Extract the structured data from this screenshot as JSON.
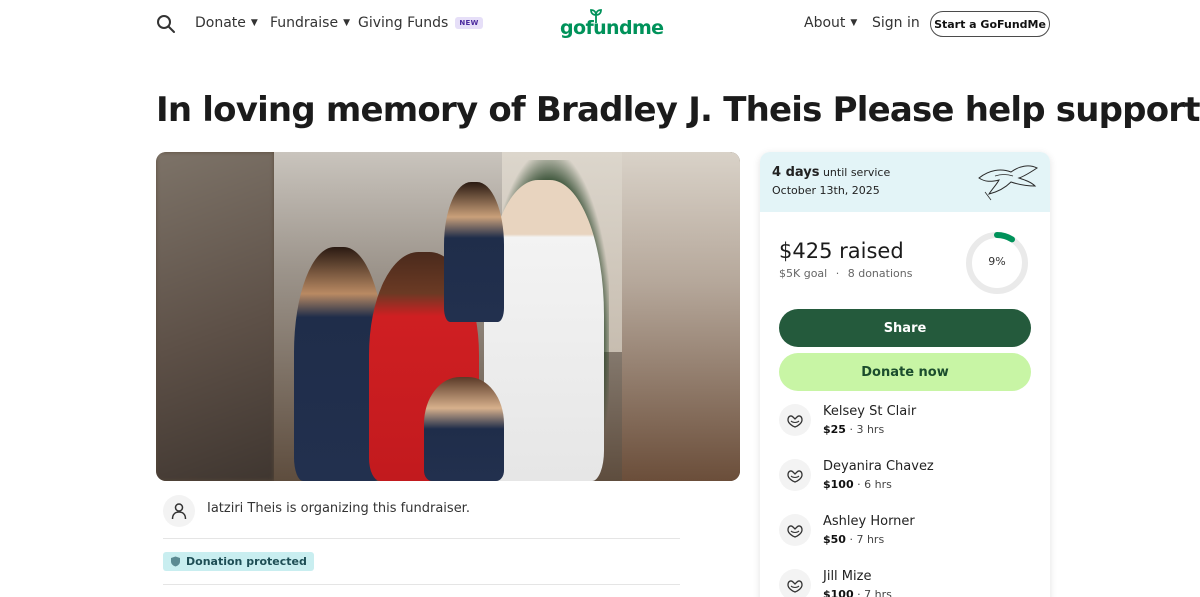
{
  "header": {
    "donate_label": "Donate",
    "fundraise_label": "Fundraise",
    "giving_funds_label": "Giving Funds",
    "new_badge": "NEW",
    "logo_text": "gofundme",
    "about_label": "About",
    "signin_label": "Sign in",
    "start_label": "Start a GoFundMe"
  },
  "campaign": {
    "title": "In loving memory of Bradley J. Theis Please help support",
    "organizer_text": "Iatziri Theis is organizing this fundraiser.",
    "protected_label": "Donation protected"
  },
  "card": {
    "days_bold": "4 days",
    "days_rest": " until service",
    "service_date": "October 13th, 2025",
    "raised": "$425 raised",
    "goal": "$5K goal",
    "separator": "·",
    "donations": "8 donations",
    "progress_percent": 9,
    "progress_label": "9%",
    "share_label": "Share",
    "donate_label": "Donate now"
  },
  "donors": [
    {
      "name": "Kelsey St Clair",
      "amount": "$25",
      "time": " · 3 hrs"
    },
    {
      "name": "Deyanira Chavez",
      "amount": "$100",
      "time": " · 6 hrs"
    },
    {
      "name": "Ashley Horner",
      "amount": "$50",
      "time": " · 7 hrs"
    },
    {
      "name": "Jill Mize",
      "amount": "$100",
      "time": " · 7 hrs"
    }
  ],
  "colors": {
    "brand_green": "#00925a",
    "share_button": "#245a3c",
    "donate_button": "#c8f5a5",
    "card_top": "#e3f4f7",
    "protected_badge": "#c9eef0"
  },
  "icons": [
    "search-icon",
    "caret-down-icon",
    "person-icon",
    "shield-icon",
    "dove-icon",
    "heart-hands-icon"
  ]
}
